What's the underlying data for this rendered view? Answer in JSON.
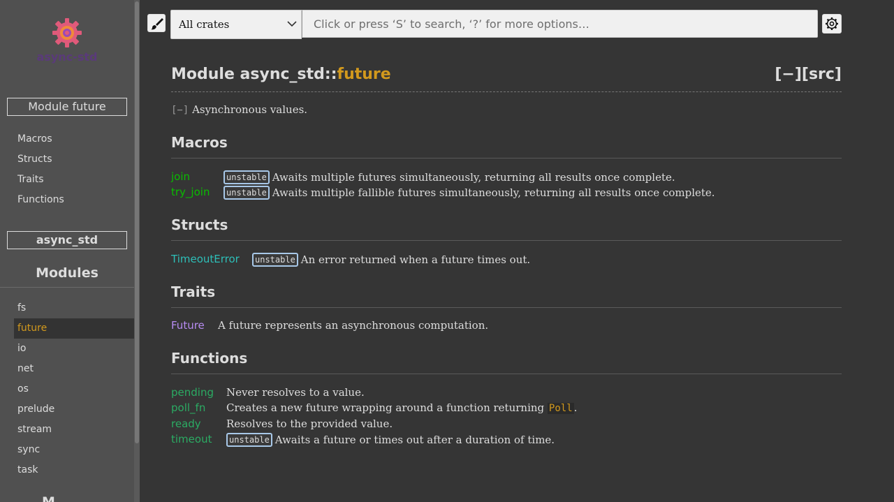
{
  "sidebar": {
    "logo_text": "async-std",
    "location_label": "Module future",
    "sections": [
      {
        "label": "Macros"
      },
      {
        "label": "Structs"
      },
      {
        "label": "Traits"
      },
      {
        "label": "Functions"
      }
    ],
    "crate_label": "async_std",
    "modules_title": "Modules",
    "modules": [
      {
        "label": "fs"
      },
      {
        "label": "future",
        "current": true
      },
      {
        "label": "io"
      },
      {
        "label": "net"
      },
      {
        "label": "os"
      },
      {
        "label": "prelude"
      },
      {
        "label": "stream"
      },
      {
        "label": "sync"
      },
      {
        "label": "task"
      }
    ],
    "trailing_title": "M..."
  },
  "search": {
    "crate_select_value": "All crates",
    "placeholder": "Click or press ‘S’ to search, ‘?’ for more options…"
  },
  "header": {
    "title_prefix": "Module ",
    "crate_path": "async_std",
    "separator": "::",
    "module_name": "future",
    "collapse_toggle": "[−]",
    "src_link": "[src]"
  },
  "summary": {
    "toggle": "[−]",
    "text": "Asynchronous values."
  },
  "stability_label": "unstable",
  "sections": {
    "macros": {
      "title": "Macros",
      "items": [
        {
          "name": "join",
          "unstable": true,
          "desc": "Awaits multiple futures simultaneously, returning all results once complete."
        },
        {
          "name": "try_join",
          "unstable": true,
          "desc": "Awaits multiple fallible futures simultaneously, returning all results once complete."
        }
      ]
    },
    "structs": {
      "title": "Structs",
      "items": [
        {
          "name": "TimeoutError",
          "unstable": true,
          "desc": "An error returned when a future times out."
        }
      ]
    },
    "traits": {
      "title": "Traits",
      "items": [
        {
          "name": "Future",
          "unstable": false,
          "desc": "A future represents an asynchronous computation."
        }
      ]
    },
    "functions": {
      "title": "Functions",
      "items": [
        {
          "name": "pending",
          "unstable": false,
          "desc": "Never resolves to a value."
        },
        {
          "name": "poll_fn",
          "unstable": false,
          "desc_before": "Creates a new future wrapping around a function returning ",
          "desc_code": "Poll",
          "desc_after": "."
        },
        {
          "name": "ready",
          "unstable": false,
          "desc": "Resolves to the provided value."
        },
        {
          "name": "timeout",
          "unstable": true,
          "desc": "Awaits a future or times out after a duration of time."
        }
      ]
    }
  },
  "colors": {
    "background": "#353535",
    "sidebar": "#505050",
    "text": "#dddddd",
    "module_accent": "#d2991d",
    "macro": "#09bd00",
    "struct": "#2dbfb8",
    "trait": "#b78cf2",
    "function": "#2bab63",
    "stability_border": "#a8c8e8"
  },
  "icons": {
    "theme_button": "paintbrush-icon",
    "settings_button": "gear-icon",
    "select_chevron": "chevron-down-icon",
    "logo": "async-std-gear-logo"
  }
}
